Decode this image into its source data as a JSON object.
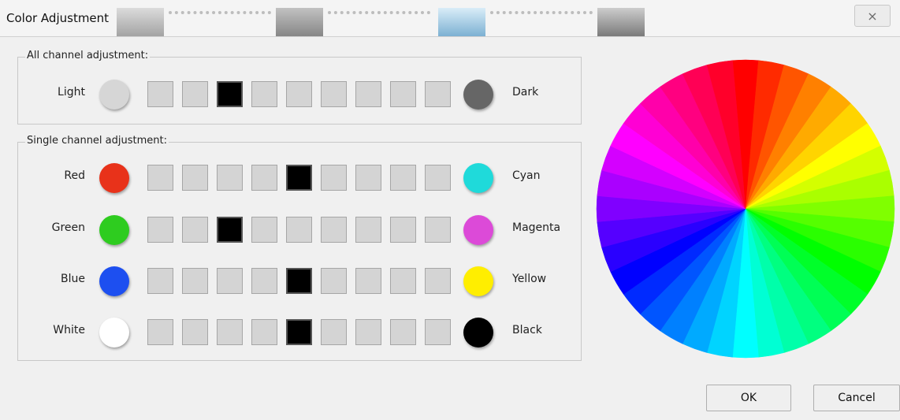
{
  "window": {
    "title": "Color Adjustment",
    "close_glyph": "×"
  },
  "groups": {
    "all_channel": {
      "label": "All channel adjustment:"
    },
    "single_channel": {
      "label": "Single channel adjustment:"
    }
  },
  "rows": [
    {
      "id": "light-dark",
      "left_label": "Light",
      "left_color": "#d6d6d6",
      "right_label": "Dark",
      "right_color": "#666666",
      "selected_index": 2,
      "steps": 9
    },
    {
      "id": "red-cyan",
      "left_label": "Red",
      "left_color": "#e8321a",
      "right_label": "Cyan",
      "right_color": "#1fdada",
      "selected_index": 4,
      "steps": 9
    },
    {
      "id": "green-magenta",
      "left_label": "Green",
      "left_color": "#2ecc1f",
      "right_label": "Magenta",
      "right_color": "#dc4ad8",
      "selected_index": 2,
      "steps": 9
    },
    {
      "id": "blue-yellow",
      "left_label": "Blue",
      "left_color": "#1d4ff0",
      "right_label": "Yellow",
      "right_color": "#ffee00",
      "selected_index": 4,
      "steps": 9
    },
    {
      "id": "white-black",
      "left_label": "White",
      "left_color": "#ffffff",
      "right_label": "Black",
      "right_color": "#000000",
      "selected_index": 4,
      "steps": 9
    }
  ],
  "buttons": {
    "ok": "OK",
    "cancel": "Cancel"
  },
  "color_wheel": {
    "segments": 36,
    "palette": [
      "#ff0000",
      "#ff2a00",
      "#ff5500",
      "#ff8000",
      "#ffaa00",
      "#ffd400",
      "#ffff00",
      "#d4ff00",
      "#aaff00",
      "#80ff00",
      "#55ff00",
      "#2aff00",
      "#00ff00",
      "#00ff2a",
      "#00ff55",
      "#00ff80",
      "#00ffaa",
      "#00ffd4",
      "#00ffff",
      "#00d4ff",
      "#00aaff",
      "#0080ff",
      "#0055ff",
      "#002aff",
      "#0000ff",
      "#2a00ff",
      "#5500ff",
      "#8000ff",
      "#aa00ff",
      "#d400ff",
      "#ff00ff",
      "#ff00d4",
      "#ff00aa",
      "#ff0080",
      "#ff0055",
      "#ff002a"
    ]
  }
}
